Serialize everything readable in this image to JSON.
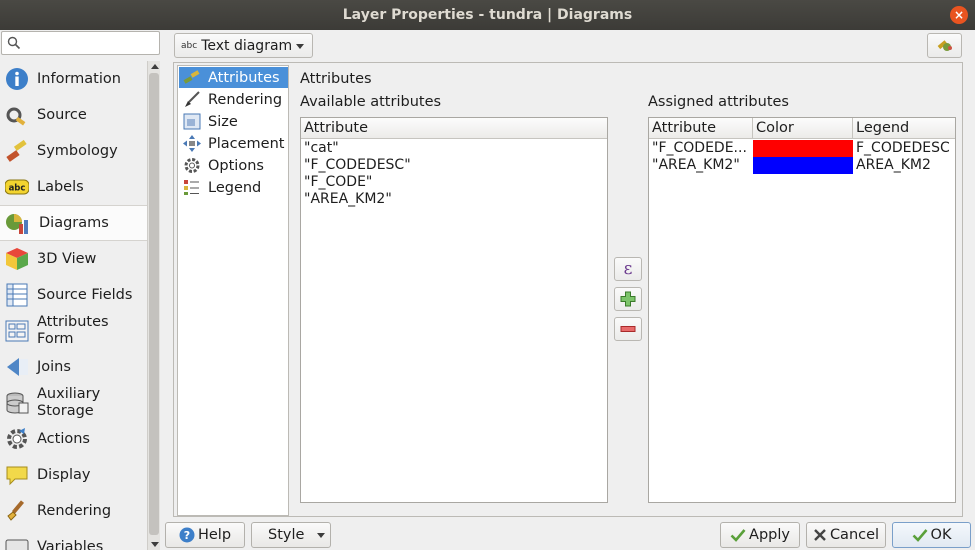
{
  "window": {
    "title": "Layer Properties - tundra | Diagrams",
    "close_glyph": "×"
  },
  "search": {
    "placeholder": "",
    "icon": "search-icon"
  },
  "nav": {
    "items": [
      {
        "label": "Information",
        "icon": "information-icon",
        "active": false
      },
      {
        "label": "Source",
        "icon": "source-icon",
        "active": false
      },
      {
        "label": "Symbology",
        "icon": "symbology-icon",
        "active": false
      },
      {
        "label": "Labels",
        "icon": "labels-icon",
        "active": false
      },
      {
        "label": "Diagrams",
        "icon": "diagrams-icon",
        "active": true
      },
      {
        "label": "3D View",
        "icon": "3d-view-icon",
        "active": false
      },
      {
        "label": "Source Fields",
        "icon": "source-fields-icon",
        "active": false
      },
      {
        "label": "Attributes Form",
        "line1": "Attributes",
        "line2": "Form",
        "icon": "attributes-form-icon",
        "active": false
      },
      {
        "label": "Joins",
        "icon": "joins-icon",
        "active": false
      },
      {
        "label": "Auxiliary Storage",
        "line1": "Auxiliary",
        "line2": "Storage",
        "icon": "auxiliary-storage-icon",
        "active": false
      },
      {
        "label": "Actions",
        "icon": "actions-icon",
        "active": false
      },
      {
        "label": "Display",
        "icon": "display-icon",
        "active": false
      },
      {
        "label": "Rendering",
        "icon": "rendering-icon",
        "active": false
      },
      {
        "label": "Variables",
        "icon": "variables-icon",
        "active": false
      }
    ]
  },
  "toolbar": {
    "diagram_type": "Text diagram",
    "diagram_type_badge": "abc"
  },
  "subnav": {
    "items": [
      {
        "label": "Attributes",
        "icon": "attributes-icon",
        "active": true
      },
      {
        "label": "Rendering",
        "icon": "brush-icon",
        "active": false
      },
      {
        "label": "Size",
        "icon": "size-icon",
        "active": false
      },
      {
        "label": "Placement",
        "icon": "placement-icon",
        "active": false
      },
      {
        "label": "Options",
        "icon": "options-icon",
        "active": false
      },
      {
        "label": "Legend",
        "icon": "legend-icon",
        "active": false
      }
    ]
  },
  "attributes_page": {
    "title": "Attributes",
    "available_label": "Available attributes",
    "assigned_label": "Assigned attributes",
    "available": {
      "header": "Attribute",
      "rows": [
        "\"cat\"",
        "\"F_CODEDESC\"",
        "\"F_CODE\"",
        "\"AREA_KM2\""
      ]
    },
    "assigned": {
      "headers": [
        "Attribute",
        "Color",
        "Legend"
      ],
      "rows": [
        {
          "attribute": "\"F_CODEDE...",
          "color": "#ff0000",
          "legend": "F_CODEDESC"
        },
        {
          "attribute": "\"AREA_KM2\"",
          "color": "#0000ff",
          "legend": "AREA_KM2"
        }
      ]
    },
    "expression_glyph": "ε"
  },
  "buttons": {
    "help": "Help",
    "style": "Style",
    "apply": "Apply",
    "cancel": "Cancel",
    "ok": "OK"
  }
}
